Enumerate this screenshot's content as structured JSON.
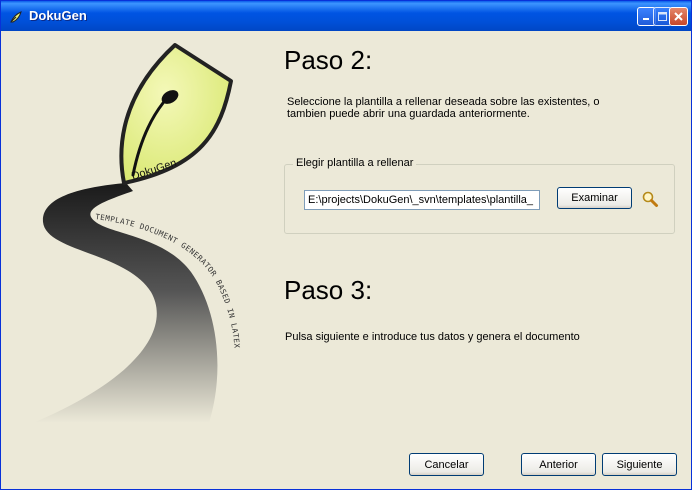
{
  "window": {
    "title": "DokuGen"
  },
  "logo": {
    "name": "DokuGen",
    "tagline": "TEMPLATE DOCUMENT GENERATOR BASED IN LATEX"
  },
  "step2": {
    "heading": "Paso 2:",
    "description_line1": "Seleccione la plantilla a rellenar deseada sobre las existentes, o",
    "description_line2": "tambien puede abrir una guardada anteriormente.",
    "group_label": "Elegir plantilla a rellenar",
    "path_value": "E:\\projects\\DokuGen\\_svn\\templates\\plantilla_",
    "browse_label": "Examinar"
  },
  "step3": {
    "heading": "Paso 3:",
    "description": "Pulsa siguiente e introduce tus datos y genera el documento"
  },
  "buttons": {
    "cancel": "Cancelar",
    "back": "Anterior",
    "next": "Siguiente"
  },
  "colors": {
    "titlebar": "#0054e3",
    "window_bg": "#ece9d8",
    "leaf": "#e4ef8e",
    "ink": "#1a1a1a"
  }
}
